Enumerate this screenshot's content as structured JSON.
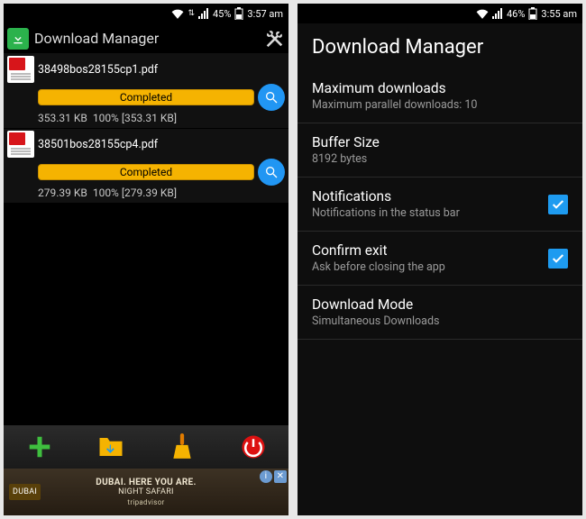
{
  "left": {
    "statusbar": {
      "battery": "45%",
      "time": "3:57 am"
    },
    "title": "Download Manager",
    "downloads": [
      {
        "name": "38498bos28155cp1.pdf",
        "status": "Completed",
        "size": "353.31 KB",
        "percent": "100%",
        "total": "[353.31 KB]"
      },
      {
        "name": "38501bos28155cp4.pdf",
        "status": "Completed",
        "size": "279.39 KB",
        "percent": "100%",
        "total": "[279.39 KB]"
      }
    ],
    "ad": {
      "line1": "DUBAI. HERE YOU ARE.",
      "line2": "NIGHT SAFARI",
      "brand": "tripadvisor",
      "badge": "DUBAI"
    }
  },
  "right": {
    "statusbar": {
      "battery": "46%",
      "time": "3:55 am"
    },
    "title": "Download Manager",
    "settings": {
      "max_dl": {
        "title": "Maximum downloads",
        "sub": "Maximum parallel downloads: 10"
      },
      "buffer": {
        "title": "Buffer Size",
        "sub": "8192 bytes"
      },
      "notify": {
        "title": "Notifications",
        "sub": "Notifications in the status bar",
        "checked": true
      },
      "confirm": {
        "title": "Confirm exit",
        "sub": "Ask before closing the app",
        "checked": true
      },
      "mode": {
        "title": "Download Mode",
        "sub": "Simultaneous Downloads"
      }
    }
  }
}
